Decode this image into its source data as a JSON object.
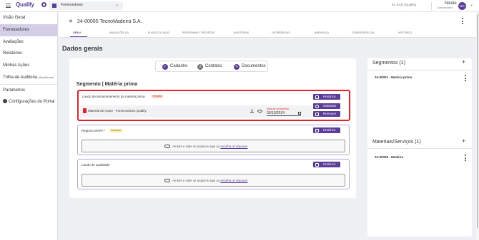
{
  "topbar": {
    "logo": "Qualify",
    "module": "Fornecedores",
    "company": "EL EAD (Qualify)",
    "user_name": "Nicole",
    "user_role": "Administrador",
    "user_initials": "NG"
  },
  "sidebar": {
    "items": [
      {
        "label": "Visão Geral"
      },
      {
        "label": "Fornecedores",
        "active": true
      },
      {
        "label": "Avaliações"
      },
      {
        "label": "Relatórios"
      },
      {
        "label": "Minhas Ações"
      },
      {
        "label": "Trilha de Auditoria",
        "sub": "(Simplificada)"
      },
      {
        "label": "Parâmetros"
      },
      {
        "label": "Configurações do Portal"
      }
    ]
  },
  "header": {
    "title": "24-00005 TecnoMadeira S.A.",
    "tabs": [
      {
        "label": "GERAL",
        "active": true
      },
      {
        "label": "AVALIAÇÕES (0)"
      },
      {
        "label": "PLANOS DE AÇÃO"
      },
      {
        "label": "PROGRAMAS E PROJETOS"
      },
      {
        "label": "AUDITORIAS"
      },
      {
        "label": "OCORRÊNCIAS"
      },
      {
        "label": "ANEXOS (0)"
      },
      {
        "label": "COMENTÁRIOS (0)"
      },
      {
        "label": "HISTÓRICO"
      }
    ]
  },
  "main": {
    "title": "Dados gerais",
    "pill_tabs": [
      "Cadastro",
      "Contatos",
      "Documentos"
    ],
    "segment_title": "Segmento | Matéria prima",
    "documents": [
      {
        "label": "Laudo de armazenamento da matéria prima",
        "badge": "Vencido",
        "file_name": "Material de Apoio - Fornecedores Qualify",
        "date_label": "Data de vencimento",
        "date_value": "03/10/2024",
        "buttons": [
          "Histórico",
          "Substituir",
          "Remover"
        ]
      },
      {
        "label": "Registro MAPA *",
        "badge": "Pendente",
        "button": "Histórico",
        "dropzone_text": "Arraste e solte os arquivos aqui ou ",
        "dropzone_link": "escolha os arquivos"
      },
      {
        "label": "Laudo de qualidade",
        "button": "Histórico",
        "dropzone_text": "Arraste e solte os arquivos aqui ou ",
        "dropzone_link": "escolha os arquivos"
      }
    ]
  },
  "right_panel": {
    "segments": {
      "title": "Segmentos (1)",
      "items": [
        "24-00001 - Matéria prima"
      ]
    },
    "materials": {
      "title": "Materiais/Serviços (1)",
      "items": [
        "24-00008 - Madeira"
      ]
    }
  },
  "colors": {
    "accent": "#5a3e99",
    "alert": "#e5212c"
  }
}
